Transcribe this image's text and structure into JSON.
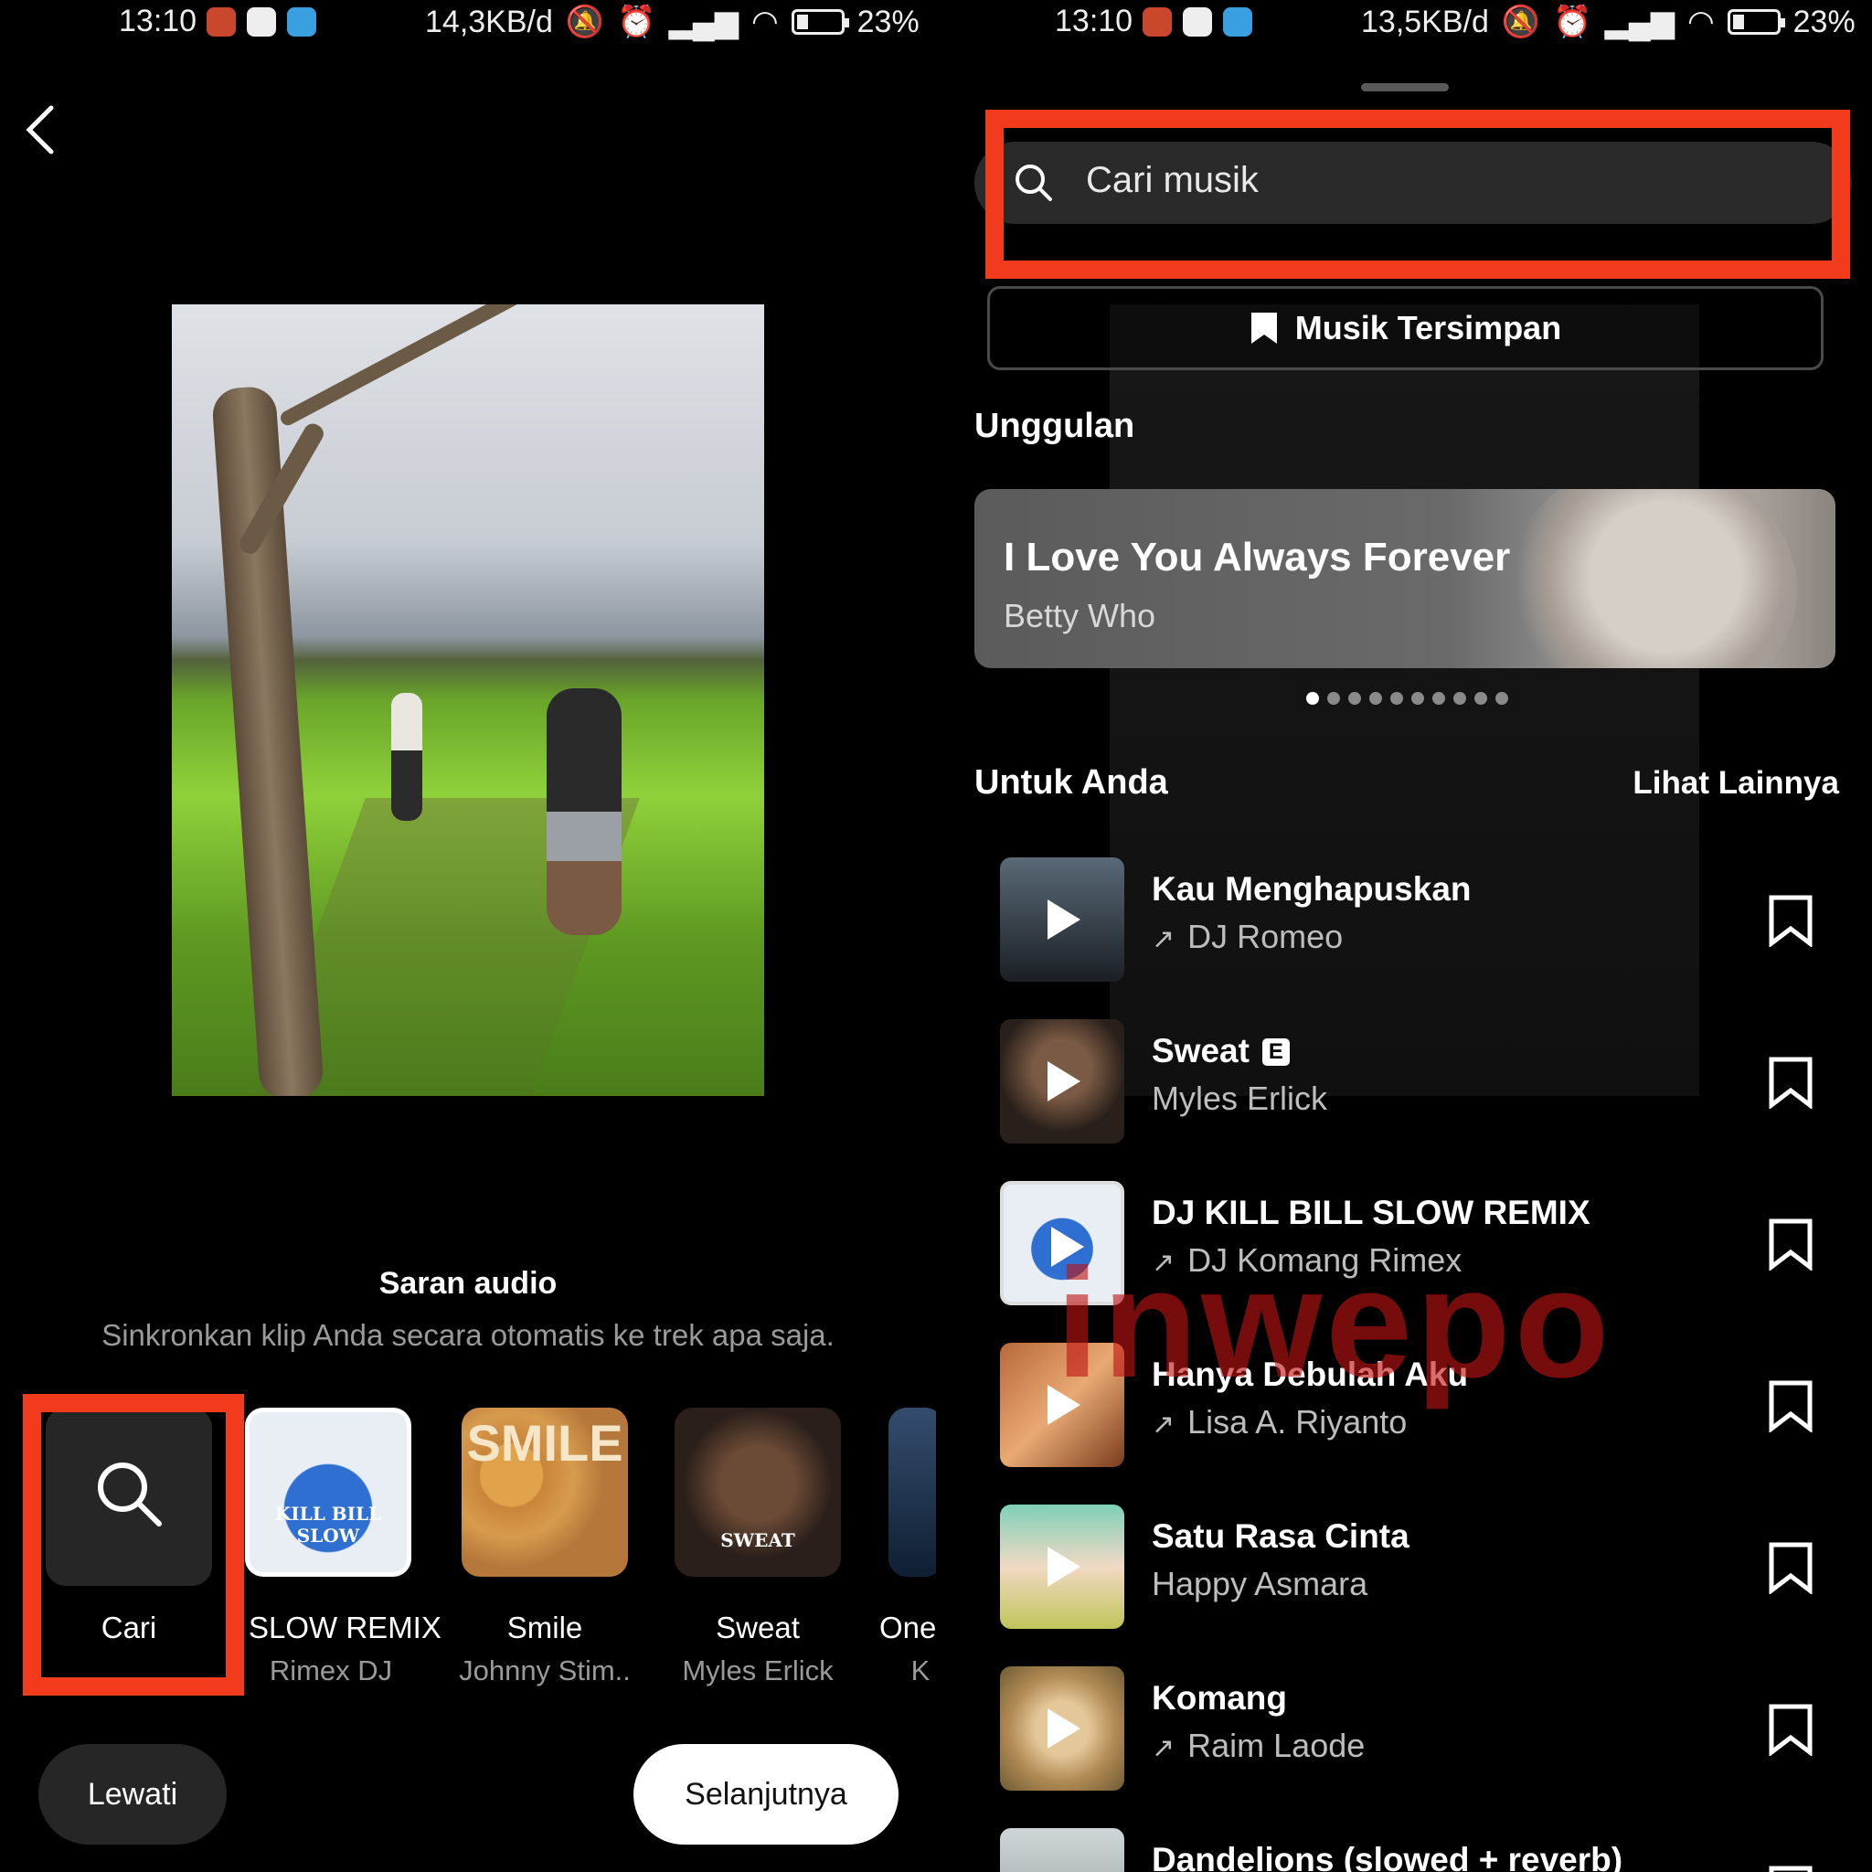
{
  "left": {
    "status": {
      "time": "13:10",
      "net_speed": "14,3KB/d",
      "battery": "23%"
    },
    "saran_title": "Saran audio",
    "saran_sub": "Sinkronkan klip Anda secara otomatis ke trek apa saja.",
    "search_tile_label": "Cari",
    "suggestions": [
      {
        "label": "SLOW REMIX",
        "artist": "Rimex    DJ",
        "thumb_text": "KILL BILL SLOW"
      },
      {
        "label": "Smile",
        "artist": "Johnny Stim..",
        "thumb_text": "SMILE"
      },
      {
        "label": "Sweat",
        "artist": "Myles Erlick",
        "thumb_text": "SWEAT"
      },
      {
        "label": "One",
        "artist": "K"
      }
    ],
    "skip_label": "Lewati",
    "next_label": "Selanjutnya"
  },
  "right": {
    "status": {
      "time": "13:10",
      "net_speed": "13,5KB/d",
      "battery": "23%"
    },
    "search_placeholder": "Cari musik",
    "saved_label": "Musik Tersimpan",
    "featured_heading": "Unggulan",
    "featured": {
      "title": "I Love You Always Forever",
      "artist": "Betty Who"
    },
    "carousel_pages": 10,
    "carousel_active": 1,
    "for_you_heading": "Untuk Anda",
    "see_more": "Lihat Lainnya",
    "tracks": [
      {
        "title": "Kau Menghapuskan",
        "artist": "DJ Romeo",
        "trending": true,
        "explicit": false
      },
      {
        "title": "Sweat",
        "artist": "Myles Erlick",
        "trending": false,
        "explicit": true,
        "explicit_label": "E"
      },
      {
        "title": "DJ KILL BILL SLOW REMIX",
        "artist": "DJ Komang Rimex",
        "trending": true,
        "explicit": false
      },
      {
        "title": "Hanya Debulah Aku",
        "artist": "Lisa A. Riyanto",
        "trending": true,
        "explicit": false
      },
      {
        "title": "Satu Rasa Cinta",
        "artist": "Happy Asmara",
        "trending": false,
        "explicit": false
      },
      {
        "title": "Komang",
        "artist": "Raim Laode",
        "trending": true,
        "explicit": false
      },
      {
        "title": "Dandelions (slowed + reverb)",
        "artist": "",
        "trending": false,
        "explicit": false
      }
    ]
  },
  "watermark": "inwepo",
  "colors": {
    "highlight": "#f23a1c",
    "background": "#000000",
    "surface": "#262626"
  }
}
